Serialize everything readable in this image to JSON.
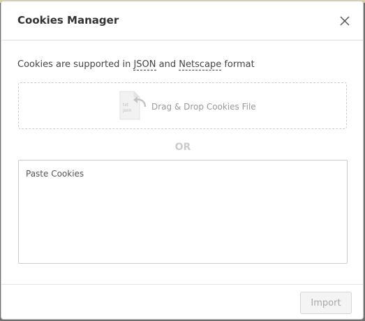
{
  "dialog": {
    "title": "Cookies Manager",
    "close_icon": "close-icon"
  },
  "body": {
    "intro_prefix": "Cookies are supported in ",
    "format_json": "JSON",
    "intro_and": " and ",
    "format_netscape": "Netscape",
    "intro_suffix": " format",
    "dropzone": {
      "icon": "file-json-icon",
      "icon_line1": "txt",
      "icon_line2": "json",
      "label": "Drag & Drop Cookies File"
    },
    "or_label": "OR",
    "paste": {
      "placeholder": "Paste Cookies",
      "value": ""
    }
  },
  "footer": {
    "import_label": "Import",
    "import_disabled": true
  },
  "colors": {
    "title_text": "#333333",
    "muted_text": "#999999",
    "border": "#cccccc",
    "divider": "#e3e3e3"
  }
}
